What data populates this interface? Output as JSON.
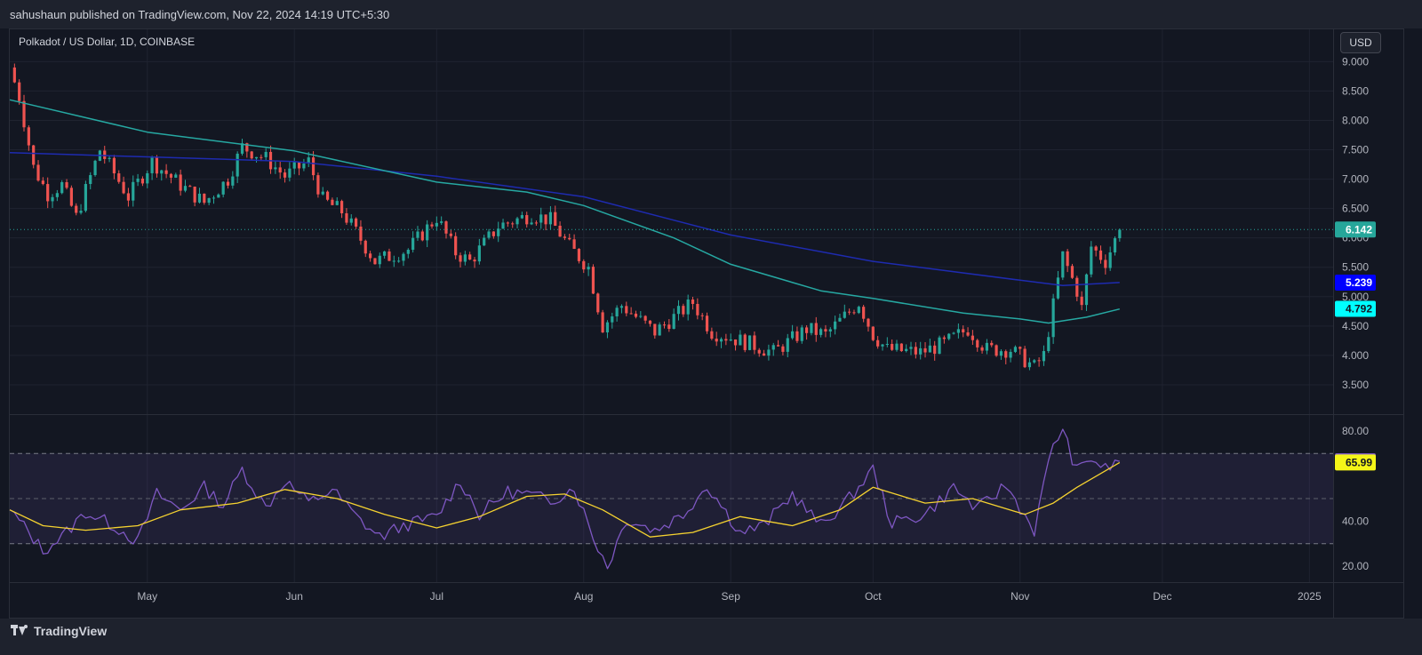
{
  "header": {
    "publisher": "sahushaun published on TradingView.com, Nov 22, 2024 14:19 UTC+5:30"
  },
  "main": {
    "symbol": "Polkadot / US Dollar, 1D, COINBASE",
    "currency_button": "USD"
  },
  "footer": {
    "brand": "TradingView"
  },
  "colors": {
    "background": "#131722",
    "grid": "#1f2330",
    "up": "#26a69a",
    "down": "#ef5350",
    "ma_long": "#1e2bb0",
    "ma_short": "#26a8a2",
    "rsi": "#7e57c2",
    "rsi_ma": "#f5d230",
    "last_price": "#26a69a",
    "ma_long_badge": "#0000ff",
    "ma_short_badge": "#00ffff",
    "rsi_badge": "#7e57c2",
    "rsi_ma_badge": "#f5f518"
  },
  "chart_data": [
    {
      "type": "candlestick",
      "title": "Polkadot / US Dollar, 1D, COINBASE",
      "y_tick_labels": [
        "9.000",
        "8.500",
        "8.000",
        "7.500",
        "7.000",
        "6.500",
        "6.000",
        "5.500",
        "5.000",
        "4.500",
        "4.000",
        "3.500"
      ],
      "ylim": [
        3.0,
        9.55
      ],
      "x_tick_labels": [
        "May",
        "Jun",
        "Jul",
        "Aug",
        "Sep",
        "Oct",
        "Nov",
        "Dec",
        "2025"
      ],
      "x_tick_dates": [
        "2024-05-01",
        "2024-06-01",
        "2024-07-01",
        "2024-08-01",
        "2024-09-01",
        "2024-10-01",
        "2024-11-01",
        "2024-12-01",
        "2025-01-01"
      ],
      "x_domain": [
        "2024-04-02",
        "2025-01-06"
      ],
      "price_path": {
        "dates": [
          "2024-04-02",
          "2024-04-04",
          "2024-04-07",
          "2024-04-10",
          "2024-04-13",
          "2024-04-16",
          "2024-04-21",
          "2024-04-27",
          "2024-05-02",
          "2024-05-08",
          "2024-05-13",
          "2024-05-18",
          "2024-05-21",
          "2024-05-26",
          "2024-05-30",
          "2024-06-04",
          "2024-06-07",
          "2024-06-11",
          "2024-06-14",
          "2024-06-18",
          "2024-06-25",
          "2024-07-01",
          "2024-07-05",
          "2024-07-08",
          "2024-07-14",
          "2024-07-21",
          "2024-07-25",
          "2024-07-29",
          "2024-08-02",
          "2024-08-05",
          "2024-08-09",
          "2024-08-16",
          "2024-08-24",
          "2024-08-28",
          "2024-09-05",
          "2024-09-10",
          "2024-09-17",
          "2024-09-21",
          "2024-09-28",
          "2024-10-01",
          "2024-10-04",
          "2024-10-11",
          "2024-10-16",
          "2024-10-21",
          "2024-10-25",
          "2024-10-30",
          "2024-11-04",
          "2024-11-06",
          "2024-11-10",
          "2024-11-11",
          "2024-11-13",
          "2024-11-14",
          "2024-11-16",
          "2024-11-19",
          "2024-11-22"
        ],
        "closes": [
          8.9,
          8.4,
          7.2,
          6.75,
          6.9,
          6.35,
          7.5,
          6.7,
          7.3,
          6.9,
          6.6,
          7.0,
          7.55,
          7.35,
          7.05,
          7.3,
          6.65,
          6.45,
          6.1,
          5.6,
          5.8,
          6.35,
          5.75,
          5.6,
          6.2,
          6.4,
          6.3,
          5.85,
          5.5,
          4.5,
          4.85,
          4.4,
          4.9,
          4.4,
          4.2,
          4.05,
          4.45,
          4.35,
          4.9,
          4.35,
          4.1,
          4.05,
          4.2,
          4.45,
          4.1,
          4.1,
          3.8,
          4.0,
          5.7,
          5.5,
          5.1,
          4.8,
          5.85,
          5.6,
          6.14
        ]
      },
      "last_price": "6.142",
      "ma_long": {
        "dates": [
          "2024-04-02",
          "2024-05-01",
          "2024-06-01",
          "2024-07-01",
          "2024-08-01",
          "2024-09-01",
          "2024-10-01",
          "2024-11-01",
          "2024-11-10",
          "2024-11-22"
        ],
        "values": [
          7.45,
          7.38,
          7.3,
          7.05,
          6.7,
          6.05,
          5.6,
          5.28,
          5.19,
          5.24
        ]
      },
      "ma_long_value": "5.239",
      "ma_short": {
        "dates": [
          "2024-04-02",
          "2024-05-01",
          "2024-06-01",
          "2024-07-01",
          "2024-07-20",
          "2024-08-01",
          "2024-08-20",
          "2024-09-01",
          "2024-09-20",
          "2024-10-01",
          "2024-10-20",
          "2024-11-01",
          "2024-11-07",
          "2024-11-15",
          "2024-11-22"
        ],
        "values": [
          8.35,
          7.8,
          7.48,
          6.95,
          6.78,
          6.55,
          6.0,
          5.55,
          5.1,
          4.97,
          4.72,
          4.62,
          4.55,
          4.65,
          4.79
        ]
      },
      "ma_short_value": "4.792"
    },
    {
      "type": "line",
      "y_tick_labels": [
        "80.00",
        "40.00",
        "20.00"
      ],
      "ylim": [
        13,
        87
      ],
      "band": [
        30,
        70
      ],
      "midline": 50,
      "rsi": {
        "dates": [
          "2024-04-02",
          "2024-04-06",
          "2024-04-09",
          "2024-04-13",
          "2024-04-18",
          "2024-04-24",
          "2024-04-29",
          "2024-05-03",
          "2024-05-08",
          "2024-05-13",
          "2024-05-17",
          "2024-05-21",
          "2024-05-26",
          "2024-05-30",
          "2024-06-04",
          "2024-06-09",
          "2024-06-14",
          "2024-06-19",
          "2024-06-24",
          "2024-07-01",
          "2024-07-06",
          "2024-07-10",
          "2024-07-16",
          "2024-07-20",
          "2024-07-25",
          "2024-07-30",
          "2024-08-03",
          "2024-08-06",
          "2024-08-10",
          "2024-08-16",
          "2024-08-22",
          "2024-08-27",
          "2024-09-03",
          "2024-09-08",
          "2024-09-14",
          "2024-09-20",
          "2024-09-26",
          "2024-10-01",
          "2024-10-05",
          "2024-10-12",
          "2024-10-18",
          "2024-10-23",
          "2024-10-29",
          "2024-11-04",
          "2024-11-08",
          "2024-11-10",
          "2024-11-13",
          "2024-11-16",
          "2024-11-19",
          "2024-11-22"
        ],
        "values": [
          45,
          35,
          27,
          33,
          44,
          38,
          31,
          52,
          45,
          55,
          47,
          63,
          46,
          58,
          48,
          54,
          42,
          33,
          38,
          42,
          58,
          43,
          53,
          52,
          49,
          55,
          33,
          20,
          41,
          36,
          43,
          56,
          35,
          38,
          52,
          38,
          50,
          63,
          39,
          43,
          55,
          45,
          56,
          36,
          75,
          80,
          62,
          68,
          63,
          66.5
        ]
      },
      "rsi_value": "66.51",
      "rsi_ma": {
        "dates": [
          "2024-04-02",
          "2024-04-09",
          "2024-04-18",
          "2024-04-29",
          "2024-05-08",
          "2024-05-20",
          "2024-05-30",
          "2024-06-10",
          "2024-06-20",
          "2024-07-01",
          "2024-07-10",
          "2024-07-20",
          "2024-07-28",
          "2024-08-05",
          "2024-08-15",
          "2024-08-24",
          "2024-09-03",
          "2024-09-14",
          "2024-09-24",
          "2024-10-01",
          "2024-10-12",
          "2024-10-22",
          "2024-11-02",
          "2024-11-08",
          "2024-11-13",
          "2024-11-22"
        ],
        "values": [
          45,
          38,
          36,
          38,
          45,
          48,
          54,
          50,
          43,
          37,
          42,
          51,
          52,
          45,
          33,
          35,
          42,
          38,
          45,
          55,
          48,
          50,
          43,
          48,
          55,
          65.99
        ]
      },
      "rsi_ma_value": "65.99"
    }
  ]
}
